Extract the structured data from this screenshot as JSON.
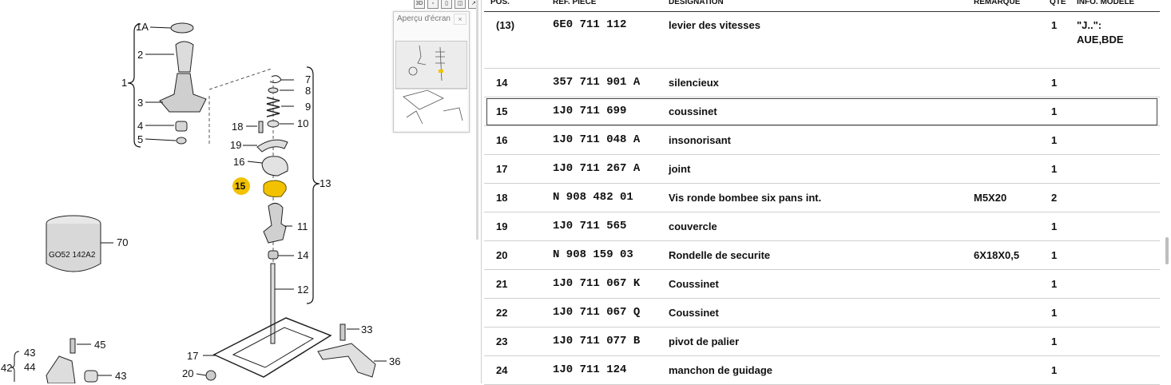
{
  "toolbar": {
    "btn1": "3D",
    "btn2": "▫",
    "btn3": "▯",
    "btn4": "◫",
    "btn5": "↗"
  },
  "preview": {
    "title": "Aperçu d'écran",
    "close": "×"
  },
  "diagram": {
    "labels": {
      "l1A": "1A",
      "l2": "2",
      "l1": "1",
      "l3": "3",
      "l4": "4",
      "l5": "5",
      "l7": "7",
      "l8": "8",
      "l9": "9",
      "l10": "10",
      "l18": "18",
      "l19": "19",
      "l16": "16",
      "l15": "15",
      "l13": "13",
      "l11": "11",
      "l14": "14",
      "l12": "12",
      "l70": "70",
      "l45": "45",
      "l43a": "43",
      "l44": "44",
      "l42": "42",
      "l43b": "43",
      "l33": "33",
      "l36": "36",
      "l17": "17",
      "l20": "20"
    },
    "part_text": "GO52 142A2"
  },
  "table": {
    "headers": {
      "pos": "POS.",
      "ref": "REF. PIECE",
      "designation": "DESIGNATION",
      "remarque": "REMARQUE",
      "qte": "QTE",
      "info": "INFO. MODELE"
    },
    "rows": [
      {
        "pos": "(13)",
        "ref": "6E0  711  112",
        "designation": "levier des vitesses",
        "remarque": "",
        "qte": "1",
        "info1": "\"J..\":",
        "info2": "AUE,BDE"
      },
      {
        "pos": "14",
        "ref": "357  711  901  A",
        "designation": "silencieux",
        "remarque": "",
        "qte": "1",
        "info1": "",
        "info2": ""
      },
      {
        "pos": "15",
        "ref": "1J0  711  699",
        "designation": "coussinet",
        "remarque": "",
        "qte": "1",
        "info1": "",
        "info2": ""
      },
      {
        "pos": "16",
        "ref": "1J0  711  048  A",
        "designation": "insonorisant",
        "remarque": "",
        "qte": "1",
        "info1": "",
        "info2": ""
      },
      {
        "pos": "17",
        "ref": "1J0  711  267  A",
        "designation": "joint",
        "remarque": "",
        "qte": "1",
        "info1": "",
        "info2": ""
      },
      {
        "pos": "18",
        "ref": "N    908  482  01",
        "designation": "Vis ronde bombee six pans int.",
        "remarque": "M5X20",
        "qte": "2",
        "info1": "",
        "info2": ""
      },
      {
        "pos": "19",
        "ref": "1J0  711  565",
        "designation": "couvercle",
        "remarque": "",
        "qte": "1",
        "info1": "",
        "info2": ""
      },
      {
        "pos": "20",
        "ref": "N    908  159  03",
        "designation": "Rondelle de securite",
        "remarque": "6X18X0,5",
        "qte": "1",
        "info1": "",
        "info2": ""
      },
      {
        "pos": "21",
        "ref": "1J0  711  067  K",
        "designation": "Coussinet",
        "remarque": "",
        "qte": "1",
        "info1": "",
        "info2": ""
      },
      {
        "pos": "22",
        "ref": "1J0  711  067  Q",
        "designation": "Coussinet",
        "remarque": "",
        "qte": "1",
        "info1": "",
        "info2": ""
      },
      {
        "pos": "23",
        "ref": "1J0  711  077  B",
        "designation": "pivot de palier",
        "remarque": "",
        "qte": "1",
        "info1": "",
        "info2": ""
      },
      {
        "pos": "24",
        "ref": "1J0  711  124",
        "designation": "manchon de guidage",
        "remarque": "",
        "qte": "1",
        "info1": "",
        "info2": ""
      }
    ]
  },
  "colors": {
    "highlight": "#f2c200",
    "border": "#444444"
  }
}
